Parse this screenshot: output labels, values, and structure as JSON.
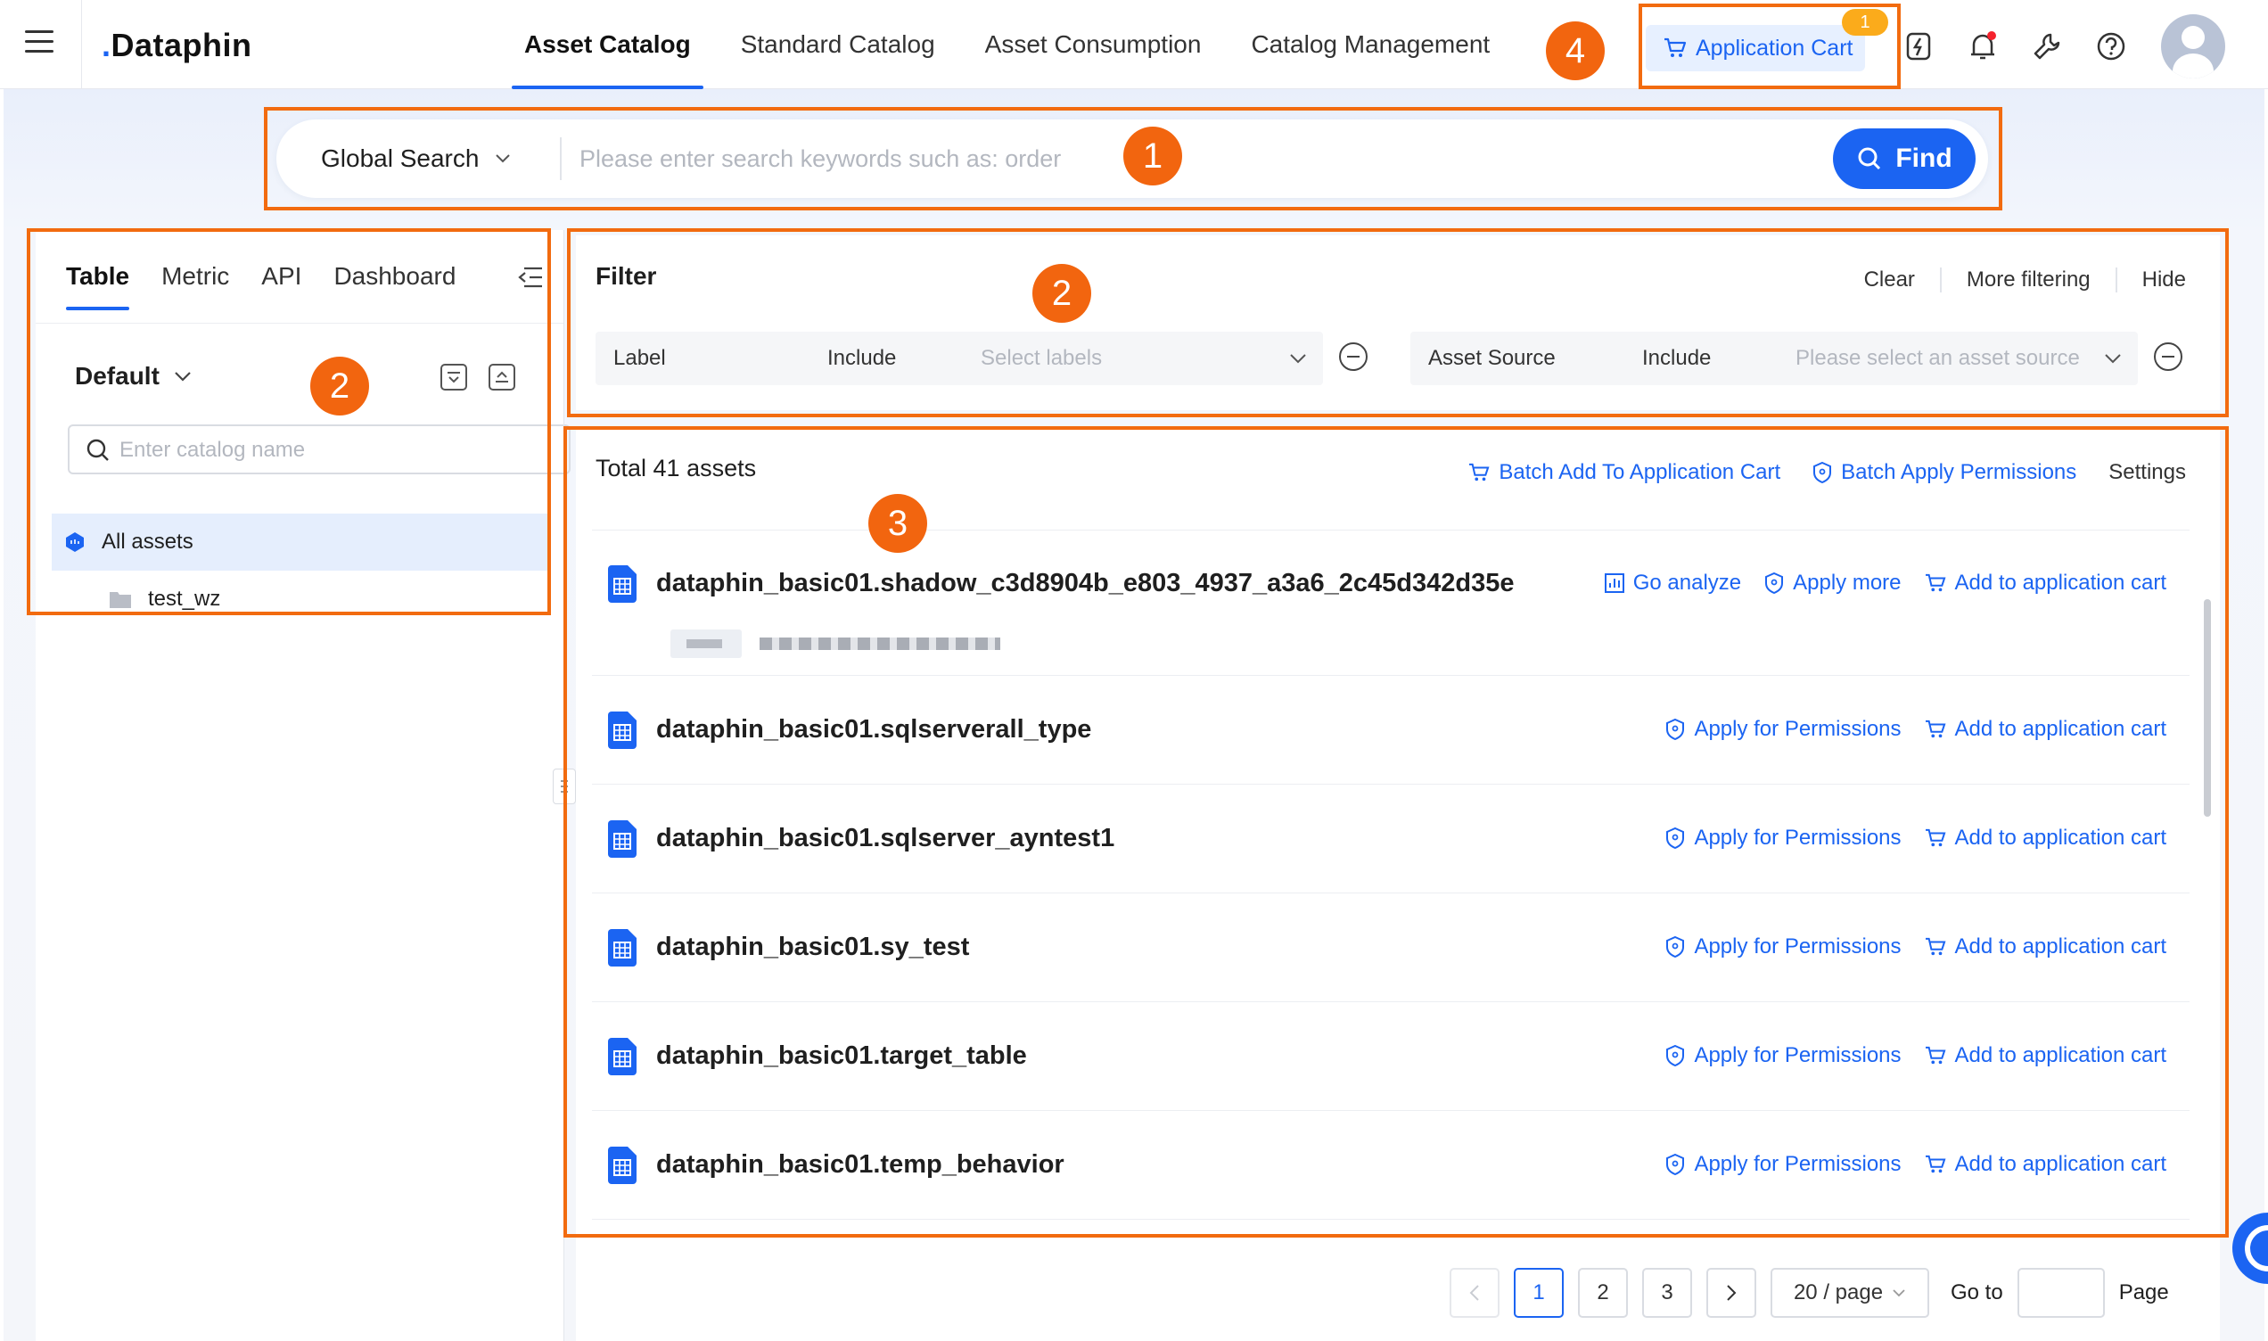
{
  "header": {
    "logo": "Dataphin",
    "nav": [
      "Asset Catalog",
      "Standard Catalog",
      "Asset Consumption",
      "Catalog Management"
    ],
    "cart_label": "Application Cart",
    "cart_count": "1"
  },
  "search": {
    "scope": "Global Search",
    "placeholder": "Please enter search keywords such as: order",
    "find_label": "Find"
  },
  "left": {
    "tabs": [
      "Table",
      "Metric",
      "API",
      "Dashboard"
    ],
    "catalog": "Default",
    "catalog_search_placeholder": "Enter catalog name",
    "tree": [
      "All assets",
      "test_wz"
    ]
  },
  "filter": {
    "title": "Filter",
    "actions": [
      "Clear",
      "More filtering",
      "Hide"
    ],
    "rows": [
      {
        "label": "Label",
        "op": "Include",
        "placeholder": "Select labels"
      },
      {
        "label": "Asset Source",
        "op": "Include",
        "placeholder": "Please select an asset source"
      }
    ]
  },
  "results": {
    "total": "Total 41 assets",
    "actions": [
      "Batch Add To Application Cart",
      "Batch Apply Permissions",
      "Settings"
    ],
    "items": [
      {
        "name": "dataphin_basic01.shadow_c3d8904b_e803_4937_a3a6_2c45d342d35e",
        "actions": [
          "Go analyze",
          "Apply more",
          "Add to application cart"
        ]
      },
      {
        "name": "dataphin_basic01.sqlserverall_type",
        "actions": [
          "Apply for Permissions",
          "Add to application cart"
        ]
      },
      {
        "name": "dataphin_basic01.sqlserver_ayntest1",
        "actions": [
          "Apply for Permissions",
          "Add to application cart"
        ]
      },
      {
        "name": "dataphin_basic01.sy_test",
        "actions": [
          "Apply for Permissions",
          "Add to application cart"
        ]
      },
      {
        "name": "dataphin_basic01.target_table",
        "actions": [
          "Apply for Permissions",
          "Add to application cart"
        ]
      },
      {
        "name": "dataphin_basic01.temp_behavior",
        "actions": [
          "Apply for Permissions",
          "Add to application cart"
        ]
      }
    ]
  },
  "pagination": {
    "pages": [
      "1",
      "2",
      "3"
    ],
    "page_size": "20 / page",
    "goto_label": "Go to",
    "page_label": "Page"
  },
  "callouts": [
    "1",
    "2",
    "2",
    "3",
    "4"
  ],
  "colors": {
    "accent": "#1b64f2",
    "annotation": "#f26b0f",
    "badge": "#fbab1b"
  }
}
